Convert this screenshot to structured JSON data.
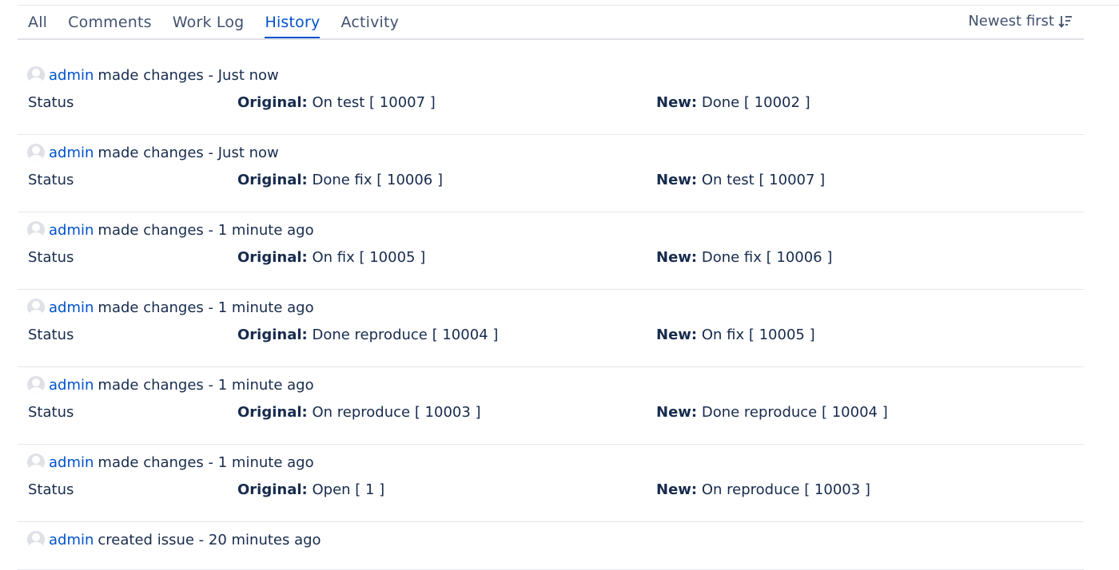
{
  "tabs": [
    {
      "label": "All",
      "active": false
    },
    {
      "label": "Comments",
      "active": false
    },
    {
      "label": "Work Log",
      "active": false
    },
    {
      "label": "History",
      "active": true
    },
    {
      "label": "Activity",
      "active": false
    }
  ],
  "sort": {
    "label": "Newest first",
    "icon": "sort-descending-icon"
  },
  "labels": {
    "original": "Original:",
    "new": "New:"
  },
  "history": [
    {
      "user": "admin",
      "action": "made changes - Just now",
      "field": "Status",
      "original": "On test [ 10007 ]",
      "new": "Done [ 10002 ]"
    },
    {
      "user": "admin",
      "action": "made changes - Just now",
      "field": "Status",
      "original": "Done fix [ 10006 ]",
      "new": "On test [ 10007 ]"
    },
    {
      "user": "admin",
      "action": "made changes - 1 minute ago",
      "field": "Status",
      "original": "On fix [ 10005 ]",
      "new": "Done fix [ 10006 ]"
    },
    {
      "user": "admin",
      "action": "made changes - 1 minute ago",
      "field": "Status",
      "original": "Done reproduce [ 10004 ]",
      "new": "On fix [ 10005 ]"
    },
    {
      "user": "admin",
      "action": "made changes - 1 minute ago",
      "field": "Status",
      "original": "On reproduce [ 10003 ]",
      "new": "Done reproduce [ 10004 ]"
    },
    {
      "user": "admin",
      "action": "made changes - 1 minute ago",
      "field": "Status",
      "original": "Open [ 1 ]",
      "new": "On reproduce [ 10003 ]"
    }
  ],
  "created": {
    "user": "admin",
    "action": "created issue - 20 minutes ago"
  },
  "colors": {
    "link": "#0052cc",
    "text": "#172b4d",
    "muted": "#42526e"
  }
}
